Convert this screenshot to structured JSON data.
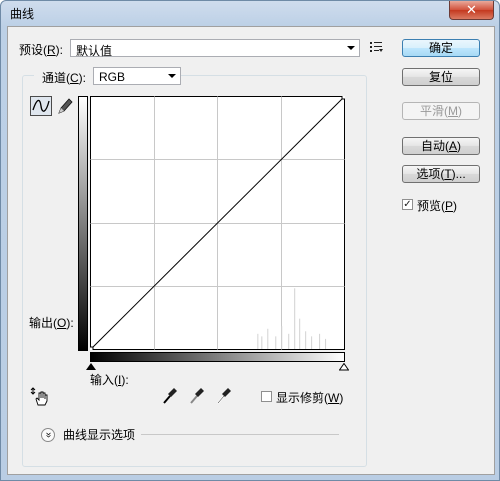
{
  "window": {
    "title": "曲线",
    "close_glyph": "✕"
  },
  "preset": {
    "label_pre": "预设(",
    "label_key": "R",
    "label_post": "):",
    "value": "默认值"
  },
  "channel": {
    "label_pre": "通道(",
    "label_key": "C",
    "label_post": "):",
    "value": "RGB"
  },
  "buttons": {
    "ok": "确定",
    "reset": "复位",
    "smooth_pre": "平滑(",
    "smooth_key": "M",
    "smooth_post": ")",
    "auto_pre": "自动(",
    "auto_key": "A",
    "auto_post": ")",
    "options_pre": "选项(",
    "options_key": "T",
    "options_post": ")..."
  },
  "preview": {
    "label_pre": "预览(",
    "label_key": "P",
    "label_post": ")",
    "checked": true,
    "check_glyph": "✓"
  },
  "output": {
    "label_pre": "输出(",
    "label_key": "O",
    "label_post": "):"
  },
  "input": {
    "label_pre": "输入(",
    "label_key": "I",
    "label_post": "):"
  },
  "show_clipping": {
    "label_pre": "显示修剪(",
    "label_key": "W",
    "label_post": ")",
    "checked": false
  },
  "display_options": {
    "label": "曲线显示选项",
    "expand_glyph": "»"
  },
  "curve": {
    "points": [
      [
        0,
        0
      ],
      [
        255,
        255
      ]
    ],
    "grid_divisions": 4,
    "histogram": [
      {
        "level": 168,
        "count": 0.06
      },
      {
        "level": 172,
        "count": 0.05
      },
      {
        "level": 178,
        "count": 0.08
      },
      {
        "level": 186,
        "count": 0.05
      },
      {
        "level": 192,
        "count": 0.09
      },
      {
        "level": 199,
        "count": 0.06
      },
      {
        "level": 205,
        "count": 0.24
      },
      {
        "level": 210,
        "count": 0.12
      },
      {
        "level": 216,
        "count": 0.07
      },
      {
        "level": 222,
        "count": 0.05
      },
      {
        "level": 230,
        "count": 0.06
      },
      {
        "level": 236,
        "count": 0.04
      }
    ],
    "colors": {
      "grid": "#c8c8c8",
      "line": "#000000",
      "histogram": "#d2d2d2",
      "accent": "#3c7fb1"
    }
  }
}
